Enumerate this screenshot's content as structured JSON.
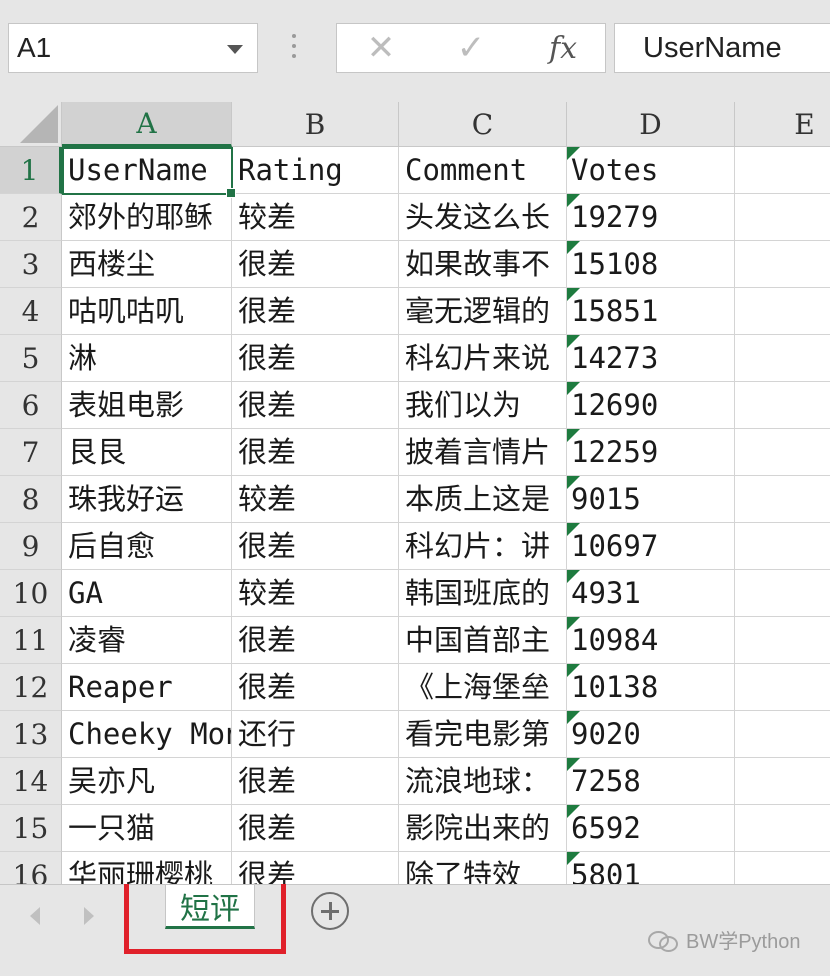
{
  "formula_bar": {
    "name_box": "A1",
    "cancel_icon": "✕",
    "enter_icon": "✓",
    "fx_label": "fx",
    "content": "UserName"
  },
  "columns": [
    {
      "label": "A",
      "width": 170
    },
    {
      "label": "B",
      "width": 167
    },
    {
      "label": "C",
      "width": 168
    },
    {
      "label": "D",
      "width": 168
    },
    {
      "label": "E",
      "width": 140
    }
  ],
  "rows": [
    {
      "num": "1",
      "cells": [
        "UserName",
        "Rating",
        "Comment",
        "Votes"
      ],
      "flag_d": true
    },
    {
      "num": "2",
      "cells": [
        "郊外的耶稣",
        "较差",
        "头发这么长",
        "19279"
      ],
      "flag_d": true
    },
    {
      "num": "3",
      "cells": [
        "西楼尘",
        "很差",
        "如果故事不",
        "15108"
      ],
      "flag_d": true
    },
    {
      "num": "4",
      "cells": [
        "咕叽咕叽",
        "很差",
        "毫无逻辑的",
        "15851"
      ],
      "flag_d": true
    },
    {
      "num": "5",
      "cells": [
        "淋",
        "很差",
        "科幻片来说",
        "14273"
      ],
      "flag_d": true
    },
    {
      "num": "6",
      "cells": [
        "表姐电影",
        "很差",
        "我们以为",
        "12690"
      ],
      "flag_d": true
    },
    {
      "num": "7",
      "cells": [
        "艮艮",
        "很差",
        "披着言情片",
        "12259"
      ],
      "flag_d": true
    },
    {
      "num": "8",
      "cells": [
        "珠我好运",
        "较差",
        "本质上这是",
        "9015"
      ],
      "flag_d": true
    },
    {
      "num": "9",
      "cells": [
        "后自愈",
        "很差",
        "科幻片：讲",
        "10697"
      ],
      "flag_d": true
    },
    {
      "num": "10",
      "cells": [
        "GA",
        "较差",
        "韩国班底的",
        "4931"
      ],
      "flag_d": true
    },
    {
      "num": "11",
      "cells": [
        "凌睿",
        "很差",
        "中国首部主",
        "10984"
      ],
      "flag_d": true
    },
    {
      "num": "12",
      "cells": [
        "Reaper",
        "很差",
        "《上海堡垒",
        "10138"
      ],
      "flag_d": true
    },
    {
      "num": "13",
      "cells": [
        "Cheeky Monkey",
        "还行",
        "看完电影第",
        "9020"
      ],
      "flag_d": true
    },
    {
      "num": "14",
      "cells": [
        "吴亦凡",
        "很差",
        "流浪地球：",
        "7258"
      ],
      "flag_d": true
    },
    {
      "num": "15",
      "cells": [
        "一只猫",
        "很差",
        "影院出来的",
        "6592"
      ],
      "flag_d": true
    },
    {
      "num": "16",
      "cells": [
        "华丽珊樱桃",
        "很差",
        "除了特效",
        "5801"
      ],
      "flag_d": true
    }
  ],
  "sheet_tabs": {
    "active": "短评",
    "add_icon": "plus-circle-icon"
  },
  "watermark": "BW学Python",
  "colors": {
    "accent": "#217346",
    "highlight": "#e0202a"
  }
}
